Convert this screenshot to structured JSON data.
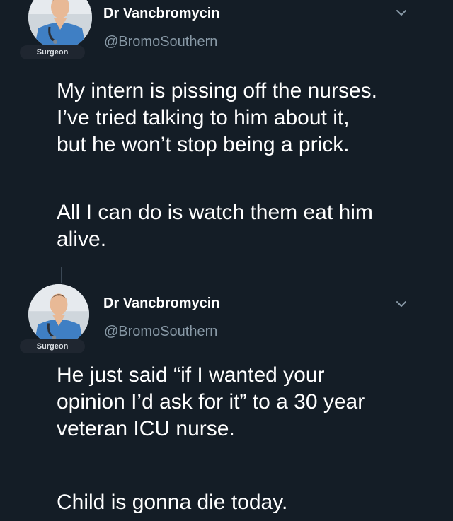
{
  "colors": {
    "background": "#141d26",
    "text": "#ffffff",
    "secondary_text": "#8899a6"
  },
  "tweets": [
    {
      "display_name": "Dr Vancbromycin",
      "handle": "@BromoSouthern",
      "avatar_badge": "Surgeon",
      "menu_icon": "chevron-down-icon",
      "text": {
        "line_1": "My intern is pissing off the nurses.",
        "line_2": "I’ve tried talking to him about it,",
        "line_3": "but he won’t stop being a prick.",
        "line_4": "All I can do is watch them eat him",
        "line_5": "alive."
      }
    },
    {
      "display_name": "Dr Vancbromycin",
      "handle": "@BromoSouthern",
      "avatar_badge": "Surgeon",
      "menu_icon": "chevron-down-icon",
      "text": {
        "line_1": "He just said “if I wanted your",
        "line_2": "opinion I’d ask for it” to a 30 year",
        "line_3": "veteran ICU nurse.",
        "line_4": "Child is gonna die today."
      }
    }
  ]
}
